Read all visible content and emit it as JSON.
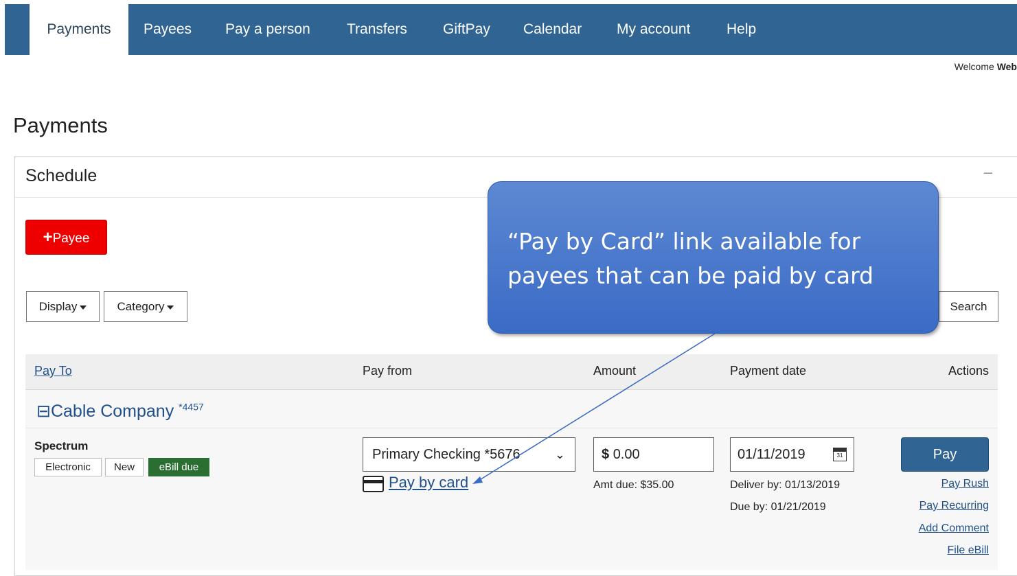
{
  "nav": {
    "tabs": [
      {
        "label": "Payments",
        "active": true
      },
      {
        "label": "Payees"
      },
      {
        "label": "Pay a person"
      },
      {
        "label": "Transfers"
      },
      {
        "label": "GiftPay"
      },
      {
        "label": "Calendar"
      },
      {
        "label": "My account"
      },
      {
        "label": "Help"
      }
    ],
    "welcome_prefix": "Welcome ",
    "welcome_name": "Web"
  },
  "page": {
    "title": "Payments"
  },
  "schedule": {
    "title": "Schedule",
    "collapse_symbol": "–",
    "add_payee_plus": "+",
    "add_payee_label": "Payee",
    "display_label": "Display",
    "category_label": "Category",
    "search_label": "Search",
    "columns": {
      "pay_to": "Pay To",
      "pay_from": "Pay from",
      "amount": "Amount",
      "payment_date": "Payment date",
      "actions": "Actions"
    },
    "group": {
      "toggle": "⊟",
      "name": "Cable Company",
      "account": "*4457"
    },
    "row": {
      "payee": "Spectrum",
      "badges": [
        "Electronic",
        "New",
        "eBill due"
      ],
      "pay_from": "Primary Checking *5676",
      "pay_by_card": "Pay by card",
      "amount_currency": "$",
      "amount_value": "0.00",
      "amt_due": "Amt due: $35.00",
      "payment_date": "01/11/2019",
      "calendar_day": "31",
      "deliver_by": "Deliver by: 01/13/2019",
      "due_by": "Due by: 01/21/2019",
      "pay_label": "Pay",
      "actions": [
        "Pay Rush",
        "Pay Recurring",
        "Add Comment",
        "File eBill"
      ]
    }
  },
  "callout": {
    "text": "“Pay by Card” link available for payees that can be paid by card"
  },
  "colors": {
    "nav": "#2f6493",
    "add_payee": "#ee0000",
    "ebill_badge": "#2a6e32",
    "callout": "#4a7ad0",
    "link": "#1f4f8c"
  }
}
